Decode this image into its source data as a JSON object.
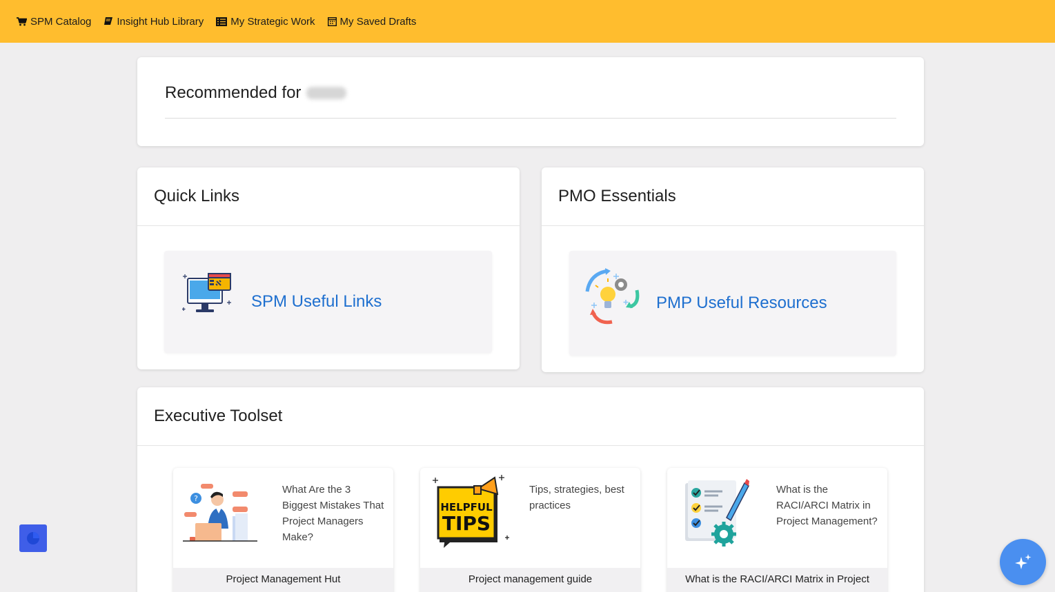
{
  "nav": {
    "items": [
      {
        "label": "SPM Catalog",
        "icon": "cart-icon"
      },
      {
        "label": "Insight Hub Library",
        "icon": "book-icon"
      },
      {
        "label": "My Strategic Work",
        "icon": "list-icon"
      },
      {
        "label": "My Saved Drafts",
        "icon": "calendar-icon"
      }
    ],
    "bar_color": "#ffbd2e"
  },
  "recommended": {
    "title": "Recommended for"
  },
  "quick_links": {
    "title": "Quick Links",
    "tile_label": "SPM Useful Links",
    "tile_icon": "monitor-link-icon"
  },
  "pmo": {
    "title": "PMO Essentials",
    "tile_label": "PMP Useful Resources",
    "tile_icon": "lightbulb-gear-icon"
  },
  "executive": {
    "title": "Executive Toolset",
    "cards": [
      {
        "desc": "What Are the 3 Biggest Mistakes That Project Managers Make?",
        "footer": "Project Management Hut",
        "thumb": "stressed-manager-illustration"
      },
      {
        "desc": "Tips, strategies, best practices",
        "footer": "Project management guide",
        "thumb": "helpful-tips-sign"
      },
      {
        "desc": "What is the RACI/ARCI Matrix in Project Management?",
        "footer": "What is the RACI/ARCI Matrix in Project",
        "thumb": "checklist-gear-illustration"
      }
    ]
  },
  "colors": {
    "link_blue": "#1e6fcf",
    "widget_blue": "#3f5ee8",
    "fab_blue": "#4a8ff0"
  }
}
